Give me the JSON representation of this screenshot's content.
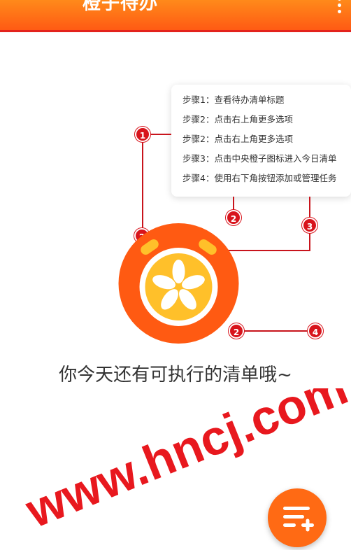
{
  "header": {
    "title": "橙子待办",
    "more_icon": "more-vertical-icon"
  },
  "tips": {
    "steps": [
      "步骤1：查看待办清单标题",
      "步骤2：点击右上角更多选项",
      "步骤2：点击右上角更多选项",
      "步骤3：点击中央橙子图标进入今日清单",
      "步骤4：使用右下角按钮添加或管理任务"
    ]
  },
  "badges": {
    "b1": "1",
    "b2a": "2",
    "b2b": "2",
    "b2c": "2",
    "b3": "3",
    "b4": "4"
  },
  "main": {
    "message": "你今天还有可执行的清单哦~",
    "logo_icon": "orange-alarm-clock-icon"
  },
  "fab": {
    "icon": "add-list-icon"
  },
  "watermark": {
    "text": "www.hncj.com"
  },
  "colors": {
    "primary": "#ff6a14",
    "accent_red": "#d8141c",
    "text": "#333333"
  }
}
